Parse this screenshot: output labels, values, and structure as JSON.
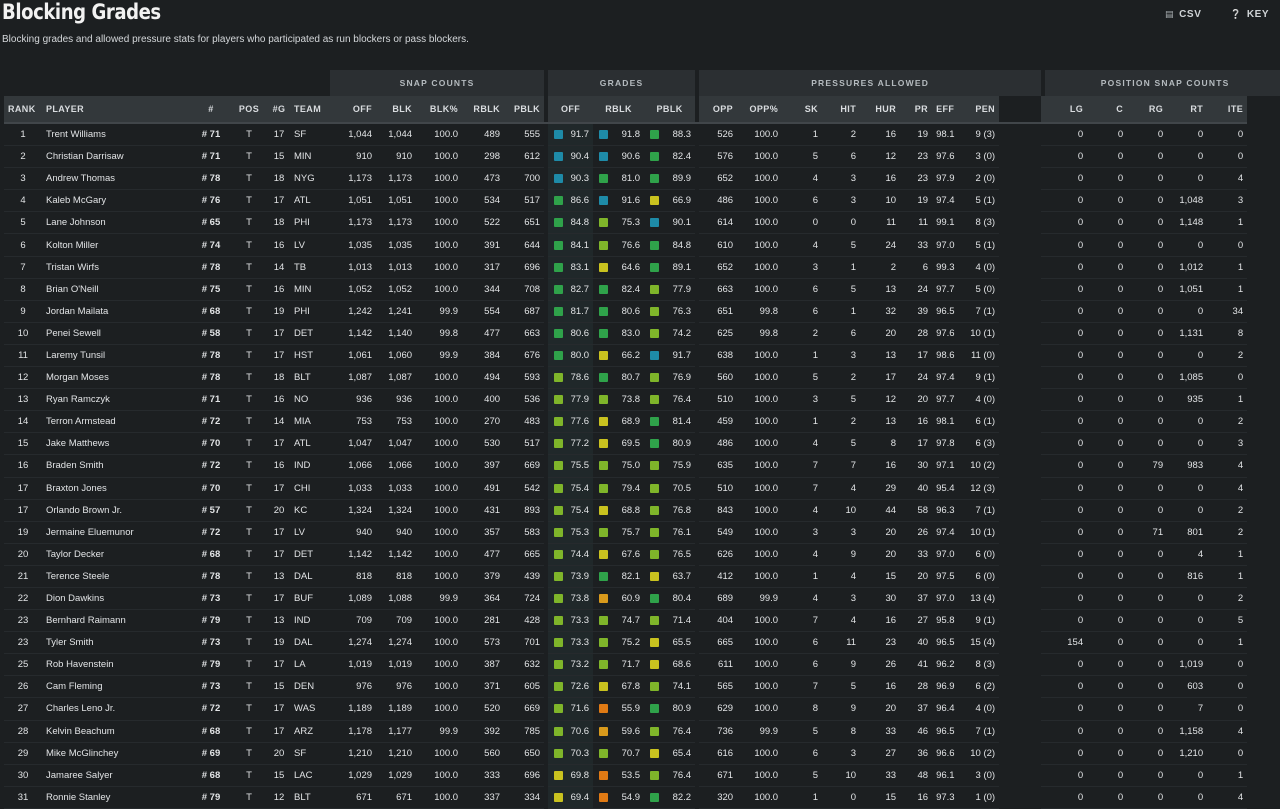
{
  "header": {
    "title": "Blocking Grades",
    "subtitle": "Blocking grades and allowed pressure stats for players who participated as run blockers or pass blockers.",
    "csv_label": "CSV",
    "key_label": "KEY"
  },
  "groups": {
    "snap_counts": "SNAP COUNTS",
    "grades": "GRADES",
    "pressures_allowed": "PRESSURES ALLOWED",
    "position_snap_counts": "POSITION SNAP COUNTS"
  },
  "columns": [
    "RANK",
    "PLAYER",
    "#",
    "POS",
    "#G",
    "TEAM",
    "OFF",
    "BLK",
    "BLK%",
    "RBLK",
    "PBLK",
    "OFF",
    "RBLK",
    "PBLK",
    "OPP",
    "OPP%",
    "SK",
    "HIT",
    "HUR",
    "PR",
    "EFF",
    "PEN",
    "LT",
    "LG",
    "C",
    "RG",
    "RT",
    "ITE"
  ],
  "grade_colors": {
    "elite": "#1e8ba8",
    "high": "#2fa24a",
    "good": "#7fb52a",
    "avg": "#c9c21f",
    "below": "#d99a1c",
    "low": "#e07a14"
  },
  "rows": [
    [
      "1",
      "Trent Williams",
      "# 71",
      "T",
      "17",
      "SF",
      "1,044",
      "1,044",
      "100.0",
      "489",
      "555",
      "91.7",
      "91.8",
      "88.3",
      "526",
      "100.0",
      "1",
      "2",
      "16",
      "19",
      "98.1",
      "9 (3)",
      "1,044",
      "0",
      "0",
      "0",
      "0",
      "0"
    ],
    [
      "2",
      "Christian Darrisaw",
      "# 71",
      "T",
      "15",
      "MIN",
      "910",
      "910",
      "100.0",
      "298",
      "612",
      "90.4",
      "90.6",
      "82.4",
      "576",
      "100.0",
      "5",
      "6",
      "12",
      "23",
      "97.6",
      "3 (0)",
      "910",
      "0",
      "0",
      "0",
      "0",
      "0"
    ],
    [
      "3",
      "Andrew Thomas",
      "# 78",
      "T",
      "18",
      "NYG",
      "1,173",
      "1,173",
      "100.0",
      "473",
      "700",
      "90.3",
      "81.0",
      "89.9",
      "652",
      "100.0",
      "4",
      "3",
      "16",
      "23",
      "97.9",
      "2 (0)",
      "1,167",
      "0",
      "0",
      "0",
      "0",
      "4"
    ],
    [
      "4",
      "Kaleb McGary",
      "# 76",
      "T",
      "17",
      "ATL",
      "1,051",
      "1,051",
      "100.0",
      "534",
      "517",
      "86.6",
      "91.6",
      "66.9",
      "486",
      "100.0",
      "6",
      "3",
      "10",
      "19",
      "97.4",
      "5 (1)",
      "0",
      "0",
      "0",
      "0",
      "1,048",
      "3"
    ],
    [
      "5",
      "Lane Johnson",
      "# 65",
      "T",
      "18",
      "PHI",
      "1,173",
      "1,173",
      "100.0",
      "522",
      "651",
      "84.8",
      "75.3",
      "90.1",
      "614",
      "100.0",
      "0",
      "0",
      "11",
      "11",
      "99.1",
      "8 (3)",
      "24",
      "0",
      "0",
      "0",
      "1,148",
      "1"
    ],
    [
      "6",
      "Kolton Miller",
      "# 74",
      "T",
      "16",
      "LV",
      "1,035",
      "1,035",
      "100.0",
      "391",
      "644",
      "84.1",
      "76.6",
      "84.8",
      "610",
      "100.0",
      "4",
      "5",
      "24",
      "33",
      "97.0",
      "5 (1)",
      "1,035",
      "0",
      "0",
      "0",
      "0",
      "0"
    ],
    [
      "7",
      "Tristan Wirfs",
      "# 78",
      "T",
      "14",
      "TB",
      "1,013",
      "1,013",
      "100.0",
      "317",
      "696",
      "83.1",
      "64.6",
      "89.1",
      "652",
      "100.0",
      "3",
      "1",
      "2",
      "6",
      "99.3",
      "4 (0)",
      "0",
      "0",
      "0",
      "0",
      "1,012",
      "1"
    ],
    [
      "8",
      "Brian O'Neill",
      "# 75",
      "T",
      "16",
      "MIN",
      "1,052",
      "1,052",
      "100.0",
      "344",
      "708",
      "82.7",
      "82.4",
      "77.9",
      "663",
      "100.0",
      "6",
      "5",
      "13",
      "24",
      "97.7",
      "5 (0)",
      "0",
      "0",
      "0",
      "0",
      "1,051",
      "1"
    ],
    [
      "9",
      "Jordan Mailata",
      "# 68",
      "T",
      "19",
      "PHI",
      "1,242",
      "1,241",
      "99.9",
      "554",
      "687",
      "81.7",
      "80.6",
      "76.3",
      "651",
      "99.8",
      "6",
      "1",
      "32",
      "39",
      "96.5",
      "7 (1)",
      "1,208",
      "0",
      "0",
      "0",
      "0",
      "34"
    ],
    [
      "10",
      "Penei Sewell",
      "# 58",
      "T",
      "17",
      "DET",
      "1,142",
      "1,140",
      "99.8",
      "477",
      "663",
      "80.6",
      "83.0",
      "74.2",
      "625",
      "99.8",
      "2",
      "6",
      "20",
      "28",
      "97.6",
      "10 (1)",
      "0",
      "0",
      "0",
      "0",
      "1,131",
      "8"
    ],
    [
      "11",
      "Laremy Tunsil",
      "# 78",
      "T",
      "17",
      "HST",
      "1,061",
      "1,060",
      "99.9",
      "384",
      "676",
      "80.0",
      "66.2",
      "91.7",
      "638",
      "100.0",
      "1",
      "3",
      "13",
      "17",
      "98.6",
      "11 (0)",
      "1,056",
      "0",
      "0",
      "0",
      "0",
      "2"
    ],
    [
      "12",
      "Morgan Moses",
      "# 78",
      "T",
      "18",
      "BLT",
      "1,087",
      "1,087",
      "100.0",
      "494",
      "593",
      "78.6",
      "80.7",
      "76.9",
      "560",
      "100.0",
      "5",
      "2",
      "17",
      "24",
      "97.4",
      "9 (1)",
      "2",
      "0",
      "0",
      "0",
      "1,085",
      "0"
    ],
    [
      "13",
      "Ryan Ramczyk",
      "# 71",
      "T",
      "16",
      "NO",
      "936",
      "936",
      "100.0",
      "400",
      "536",
      "77.9",
      "73.8",
      "76.4",
      "510",
      "100.0",
      "3",
      "5",
      "12",
      "20",
      "97.7",
      "4 (0)",
      "0",
      "0",
      "0",
      "0",
      "935",
      "1"
    ],
    [
      "14",
      "Terron Armstead",
      "# 72",
      "T",
      "14",
      "MIA",
      "753",
      "753",
      "100.0",
      "270",
      "483",
      "77.6",
      "68.9",
      "81.4",
      "459",
      "100.0",
      "1",
      "2",
      "13",
      "16",
      "98.1",
      "6 (1)",
      "751",
      "0",
      "0",
      "0",
      "0",
      "2"
    ],
    [
      "15",
      "Jake Matthews",
      "# 70",
      "T",
      "17",
      "ATL",
      "1,047",
      "1,047",
      "100.0",
      "530",
      "517",
      "77.2",
      "69.5",
      "80.9",
      "486",
      "100.0",
      "4",
      "5",
      "8",
      "17",
      "97.8",
      "6 (3)",
      "1,044",
      "0",
      "0",
      "0",
      "0",
      "3"
    ],
    [
      "16",
      "Braden Smith",
      "# 72",
      "T",
      "16",
      "IND",
      "1,066",
      "1,066",
      "100.0",
      "397",
      "669",
      "75.5",
      "75.0",
      "75.9",
      "635",
      "100.0",
      "7",
      "7",
      "16",
      "30",
      "97.1",
      "10 (2)",
      "0",
      "0",
      "0",
      "79",
      "983",
      "4"
    ],
    [
      "17",
      "Braxton Jones",
      "# 70",
      "T",
      "17",
      "CHI",
      "1,033",
      "1,033",
      "100.0",
      "491",
      "542",
      "75.4",
      "79.4",
      "70.5",
      "510",
      "100.0",
      "7",
      "4",
      "29",
      "40",
      "95.4",
      "12 (3)",
      "1,029",
      "0",
      "0",
      "0",
      "0",
      "4"
    ],
    [
      "17",
      "Orlando Brown Jr.",
      "# 57",
      "T",
      "20",
      "KC",
      "1,324",
      "1,324",
      "100.0",
      "431",
      "893",
      "75.4",
      "68.8",
      "76.8",
      "843",
      "100.0",
      "4",
      "10",
      "44",
      "58",
      "96.3",
      "7 (1)",
      "1,322",
      "0",
      "0",
      "0",
      "0",
      "2"
    ],
    [
      "19",
      "Jermaine Eluemunor",
      "# 72",
      "T",
      "17",
      "LV",
      "940",
      "940",
      "100.0",
      "357",
      "583",
      "75.3",
      "75.7",
      "76.1",
      "549",
      "100.0",
      "3",
      "3",
      "20",
      "26",
      "97.4",
      "10 (1)",
      "66",
      "0",
      "0",
      "71",
      "801",
      "2"
    ],
    [
      "20",
      "Taylor Decker",
      "# 68",
      "T",
      "17",
      "DET",
      "1,142",
      "1,142",
      "100.0",
      "477",
      "665",
      "74.4",
      "67.6",
      "76.5",
      "626",
      "100.0",
      "4",
      "9",
      "20",
      "33",
      "97.0",
      "6 (0)",
      "1,137",
      "0",
      "0",
      "0",
      "4",
      "1"
    ],
    [
      "21",
      "Terence Steele",
      "# 78",
      "T",
      "13",
      "DAL",
      "818",
      "818",
      "100.0",
      "379",
      "439",
      "73.9",
      "82.1",
      "63.7",
      "412",
      "100.0",
      "1",
      "4",
      "15",
      "20",
      "97.5",
      "6 (0)",
      "0",
      "0",
      "0",
      "0",
      "816",
      "1"
    ],
    [
      "22",
      "Dion Dawkins",
      "# 73",
      "T",
      "17",
      "BUF",
      "1,089",
      "1,088",
      "99.9",
      "364",
      "724",
      "73.8",
      "60.9",
      "80.4",
      "689",
      "99.9",
      "4",
      "3",
      "30",
      "37",
      "97.0",
      "13 (4)",
      "1,087",
      "0",
      "0",
      "0",
      "0",
      "2"
    ],
    [
      "23",
      "Bernhard Raimann",
      "# 79",
      "T",
      "13",
      "IND",
      "709",
      "709",
      "100.0",
      "281",
      "428",
      "73.3",
      "74.7",
      "71.4",
      "404",
      "100.0",
      "7",
      "4",
      "16",
      "27",
      "95.8",
      "9 (1)",
      "704",
      "0",
      "0",
      "0",
      "0",
      "5"
    ],
    [
      "23",
      "Tyler Smith",
      "# 73",
      "T",
      "19",
      "DAL",
      "1,274",
      "1,274",
      "100.0",
      "573",
      "701",
      "73.3",
      "75.2",
      "65.5",
      "665",
      "100.0",
      "6",
      "11",
      "23",
      "40",
      "96.5",
      "15 (4)",
      "1,118",
      "154",
      "0",
      "0",
      "0",
      "1"
    ],
    [
      "25",
      "Rob Havenstein",
      "# 79",
      "T",
      "17",
      "LA",
      "1,019",
      "1,019",
      "100.0",
      "387",
      "632",
      "73.2",
      "71.7",
      "68.6",
      "611",
      "100.0",
      "6",
      "9",
      "26",
      "41",
      "96.2",
      "8 (3)",
      "0",
      "0",
      "0",
      "0",
      "1,019",
      "0"
    ],
    [
      "26",
      "Cam Fleming",
      "# 73",
      "T",
      "15",
      "DEN",
      "976",
      "976",
      "100.0",
      "371",
      "605",
      "72.6",
      "67.8",
      "74.1",
      "565",
      "100.0",
      "7",
      "5",
      "16",
      "28",
      "96.9",
      "6 (2)",
      "373",
      "0",
      "0",
      "0",
      "603",
      "0"
    ],
    [
      "27",
      "Charles Leno Jr.",
      "# 72",
      "T",
      "17",
      "WAS",
      "1,189",
      "1,189",
      "100.0",
      "520",
      "669",
      "71.6",
      "55.9",
      "80.9",
      "629",
      "100.0",
      "8",
      "9",
      "20",
      "37",
      "96.4",
      "4 (0)",
      "1,182",
      "0",
      "0",
      "0",
      "7",
      "0"
    ],
    [
      "28",
      "Kelvin Beachum",
      "# 68",
      "T",
      "17",
      "ARZ",
      "1,178",
      "1,177",
      "99.9",
      "392",
      "785",
      "70.6",
      "59.6",
      "76.4",
      "736",
      "99.9",
      "5",
      "8",
      "33",
      "46",
      "96.5",
      "7 (1)",
      "16",
      "0",
      "0",
      "0",
      "1,158",
      "4"
    ],
    [
      "29",
      "Mike McGlinchey",
      "# 69",
      "T",
      "20",
      "SF",
      "1,210",
      "1,210",
      "100.0",
      "560",
      "650",
      "70.3",
      "70.7",
      "65.4",
      "616",
      "100.0",
      "6",
      "3",
      "27",
      "36",
      "96.6",
      "10 (2)",
      "0",
      "0",
      "0",
      "0",
      "1,210",
      "0"
    ],
    [
      "30",
      "Jamaree Salyer",
      "# 68",
      "T",
      "15",
      "LAC",
      "1,029",
      "1,029",
      "100.0",
      "333",
      "696",
      "69.8",
      "53.5",
      "76.4",
      "671",
      "100.0",
      "5",
      "10",
      "33",
      "48",
      "96.1",
      "3 (0)",
      "1,028",
      "0",
      "0",
      "0",
      "0",
      "1"
    ],
    [
      "31",
      "Ronnie Stanley",
      "# 79",
      "T",
      "12",
      "BLT",
      "671",
      "671",
      "100.0",
      "337",
      "334",
      "69.4",
      "54.9",
      "82.2",
      "320",
      "100.0",
      "1",
      "0",
      "15",
      "16",
      "97.3",
      "1 (0)",
      "667",
      "0",
      "0",
      "0",
      "0",
      "4"
    ]
  ]
}
